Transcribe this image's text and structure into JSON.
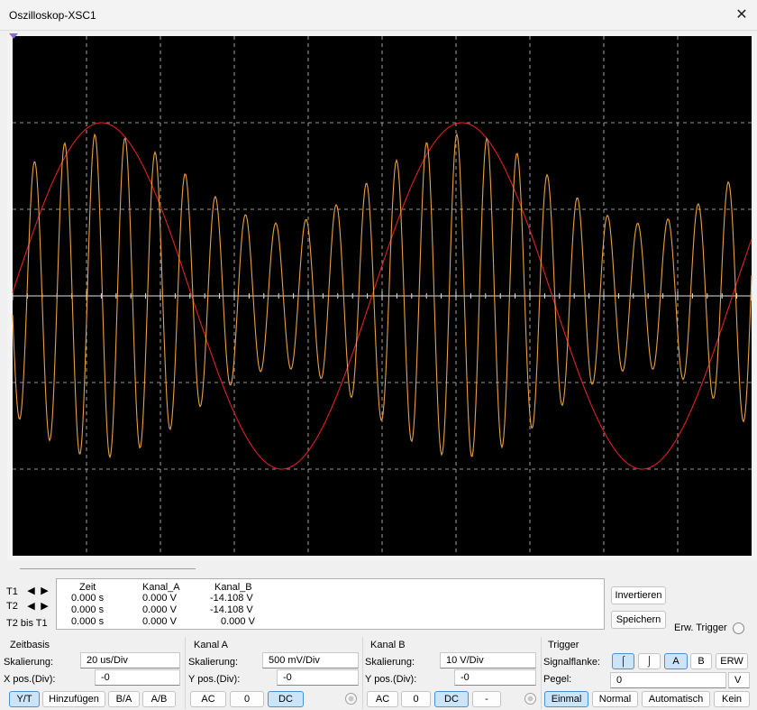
{
  "window": {
    "title": "Oszilloskop-XSC1",
    "close_glyph": "✕"
  },
  "colors": {
    "screen_bg": "#000000",
    "grid": "#c8c8c8",
    "channel_a": "#e8a040",
    "channel_b": "#e02020",
    "active_button": "#cce4f7"
  },
  "cursors": {
    "t1_label": "T1",
    "t2_label": "T2",
    "diff_label": "T2 bis T1",
    "left_arrow": "🡸",
    "right_arrow": "🡺"
  },
  "measurements": {
    "headers": [
      "Zeit",
      "Kanal_A",
      "Kanal_B"
    ],
    "rows": [
      [
        "0.000 s",
        "0.000 V",
        "-14.108 V"
      ],
      [
        "0.000 s",
        "0.000 V",
        "-14.108 V"
      ],
      [
        "0.000 s",
        "0.000 V",
        "0.000 V"
      ]
    ]
  },
  "side_buttons": {
    "invert": "Invertieren",
    "save": "Speichern",
    "ext_trigger": "Erw. Trigger"
  },
  "zeitbasis": {
    "title": "Zeitbasis",
    "scale_label": "Skalierung:",
    "scale_value": "20 us/Div",
    "xpos_label": "X pos.(Div):",
    "xpos_value": "-0",
    "buttons": [
      "Y/T",
      "Hinzufügen",
      "B/A",
      "A/B"
    ]
  },
  "kanal_a": {
    "title": "Kanal A",
    "scale_label": "Skalierung:",
    "scale_value": "500 mV/Div",
    "ypos_label": "Y pos.(Div):",
    "ypos_value": "-0",
    "buttons": [
      "AC",
      "0",
      "DC"
    ]
  },
  "kanal_b": {
    "title": "Kanal B",
    "scale_label": "Skalierung:",
    "scale_value": "10  V/Div",
    "ypos_label": "Y pos.(Div):",
    "ypos_value": "-0",
    "buttons": [
      "AC",
      "0",
      "DC",
      "-"
    ]
  },
  "trigger": {
    "title": "Trigger",
    "edge_label": "Signalflanke:",
    "edge_rise_icon": "⨍",
    "edge_fall_icon": "⫯",
    "source_buttons": [
      "A",
      "B",
      "ERW"
    ],
    "level_label": "Pegel:",
    "level_value": "0",
    "level_unit": "V",
    "mode_buttons": [
      "Einmal",
      "Normal",
      "Automatisch",
      "Kein"
    ]
  },
  "waveforms": {
    "channel_a": {
      "label": "Kanal A",
      "amplitude_div": 2.05,
      "carrier_periods_per_div": 0.82,
      "envelope_periods": 2.05
    },
    "channel_b": {
      "label": "Kanal B",
      "amplitude_div": 2.0,
      "periods": 2.05
    }
  }
}
